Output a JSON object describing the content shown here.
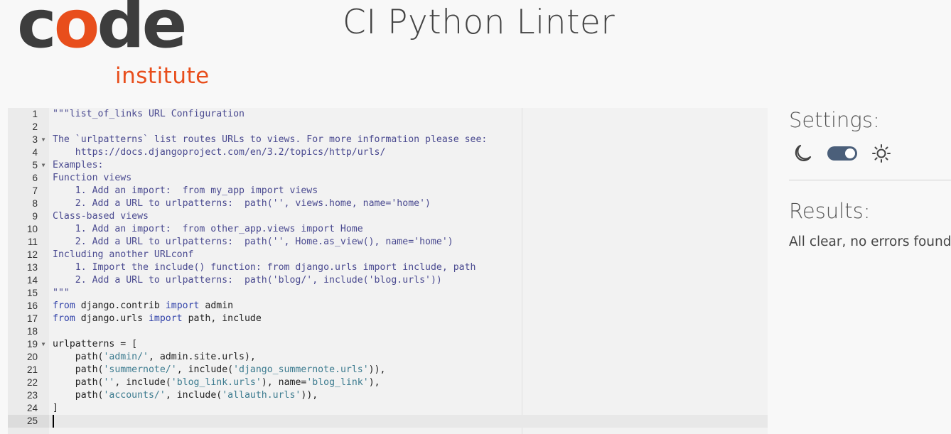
{
  "logo": {
    "code_c": "c",
    "code_o": "o",
    "code_de": "de",
    "institute": "institute"
  },
  "header": {
    "title": "CI Python Linter"
  },
  "editor": {
    "active_line": 25,
    "lines": [
      {
        "n": "1",
        "fold": false,
        "segments": [
          {
            "t": "\"\"\"list_of_links URL Configuration",
            "c": "str"
          }
        ]
      },
      {
        "n": "2",
        "fold": false,
        "segments": []
      },
      {
        "n": "3",
        "fold": true,
        "segments": [
          {
            "t": "The `urlpatterns` list routes URLs to views. For more information please see:",
            "c": "str"
          }
        ]
      },
      {
        "n": "4",
        "fold": false,
        "segments": [
          {
            "t": "    https://docs.djangoproject.com/en/3.2/topics/http/urls/",
            "c": "str"
          }
        ]
      },
      {
        "n": "5",
        "fold": true,
        "segments": [
          {
            "t": "Examples:",
            "c": "str"
          }
        ]
      },
      {
        "n": "6",
        "fold": false,
        "segments": [
          {
            "t": "Function views",
            "c": "str"
          }
        ]
      },
      {
        "n": "7",
        "fold": false,
        "segments": [
          {
            "t": "    1. Add an import:  from my_app import views",
            "c": "str"
          }
        ]
      },
      {
        "n": "8",
        "fold": false,
        "segments": [
          {
            "t": "    2. Add a URL to urlpatterns:  path('', views.home, name='home')",
            "c": "str"
          }
        ]
      },
      {
        "n": "9",
        "fold": false,
        "segments": [
          {
            "t": "Class-based views",
            "c": "str"
          }
        ]
      },
      {
        "n": "10",
        "fold": false,
        "segments": [
          {
            "t": "    1. Add an import:  from other_app.views import Home",
            "c": "str"
          }
        ]
      },
      {
        "n": "11",
        "fold": false,
        "segments": [
          {
            "t": "    2. Add a URL to urlpatterns:  path('', Home.as_view(), name='home')",
            "c": "str"
          }
        ]
      },
      {
        "n": "12",
        "fold": false,
        "segments": [
          {
            "t": "Including another URLconf",
            "c": "str"
          }
        ]
      },
      {
        "n": "13",
        "fold": false,
        "segments": [
          {
            "t": "    1. Import the include() function: from django.urls import include, path",
            "c": "str"
          }
        ]
      },
      {
        "n": "14",
        "fold": false,
        "segments": [
          {
            "t": "    2. Add a URL to urlpatterns:  path('blog/', include('blog.urls'))",
            "c": "str"
          }
        ]
      },
      {
        "n": "15",
        "fold": false,
        "segments": [
          {
            "t": "\"\"\"",
            "c": "str"
          }
        ]
      },
      {
        "n": "16",
        "fold": false,
        "segments": [
          {
            "t": "from",
            "c": "kw"
          },
          {
            "t": " django.contrib ",
            "c": "id"
          },
          {
            "t": "import",
            "c": "kw"
          },
          {
            "t": " admin",
            "c": "id"
          }
        ]
      },
      {
        "n": "17",
        "fold": false,
        "segments": [
          {
            "t": "from",
            "c": "kw"
          },
          {
            "t": " django.urls ",
            "c": "id"
          },
          {
            "t": "import",
            "c": "kw"
          },
          {
            "t": " path, include",
            "c": "id"
          }
        ]
      },
      {
        "n": "18",
        "fold": false,
        "segments": []
      },
      {
        "n": "19",
        "fold": true,
        "segments": [
          {
            "t": "urlpatterns = [",
            "c": "id"
          }
        ]
      },
      {
        "n": "20",
        "fold": false,
        "segments": [
          {
            "t": "    path(",
            "c": "id"
          },
          {
            "t": "'admin/'",
            "c": "q"
          },
          {
            "t": ", admin.site.urls),",
            "c": "id"
          }
        ]
      },
      {
        "n": "21",
        "fold": false,
        "segments": [
          {
            "t": "    path(",
            "c": "id"
          },
          {
            "t": "'summernote/'",
            "c": "q"
          },
          {
            "t": ", include(",
            "c": "id"
          },
          {
            "t": "'django_summernote.urls'",
            "c": "q"
          },
          {
            "t": ")),",
            "c": "id"
          }
        ]
      },
      {
        "n": "22",
        "fold": false,
        "segments": [
          {
            "t": "    path(",
            "c": "id"
          },
          {
            "t": "''",
            "c": "q"
          },
          {
            "t": ", include(",
            "c": "id"
          },
          {
            "t": "'blog_link.urls'",
            "c": "q"
          },
          {
            "t": "), name=",
            "c": "id"
          },
          {
            "t": "'blog_link'",
            "c": "q"
          },
          {
            "t": "),",
            "c": "id"
          }
        ]
      },
      {
        "n": "23",
        "fold": false,
        "segments": [
          {
            "t": "    path(",
            "c": "id"
          },
          {
            "t": "'accounts/'",
            "c": "q"
          },
          {
            "t": ", include(",
            "c": "id"
          },
          {
            "t": "'allauth.urls'",
            "c": "q"
          },
          {
            "t": ")),",
            "c": "id"
          }
        ]
      },
      {
        "n": "24",
        "fold": false,
        "segments": [
          {
            "t": "]",
            "c": "id"
          }
        ]
      },
      {
        "n": "25",
        "fold": false,
        "segments": []
      }
    ]
  },
  "settings": {
    "title": "Settings:",
    "dark_mode_icon": "moon-icon",
    "light_mode_icon": "sun-icon",
    "theme_toggle_on": true
  },
  "results": {
    "title": "Results:",
    "message": "All clear, no errors found"
  },
  "colors": {
    "brand_orange": "#e84e1c",
    "brand_dark": "#3d3d3d",
    "toggle": "#4b5f7a"
  }
}
